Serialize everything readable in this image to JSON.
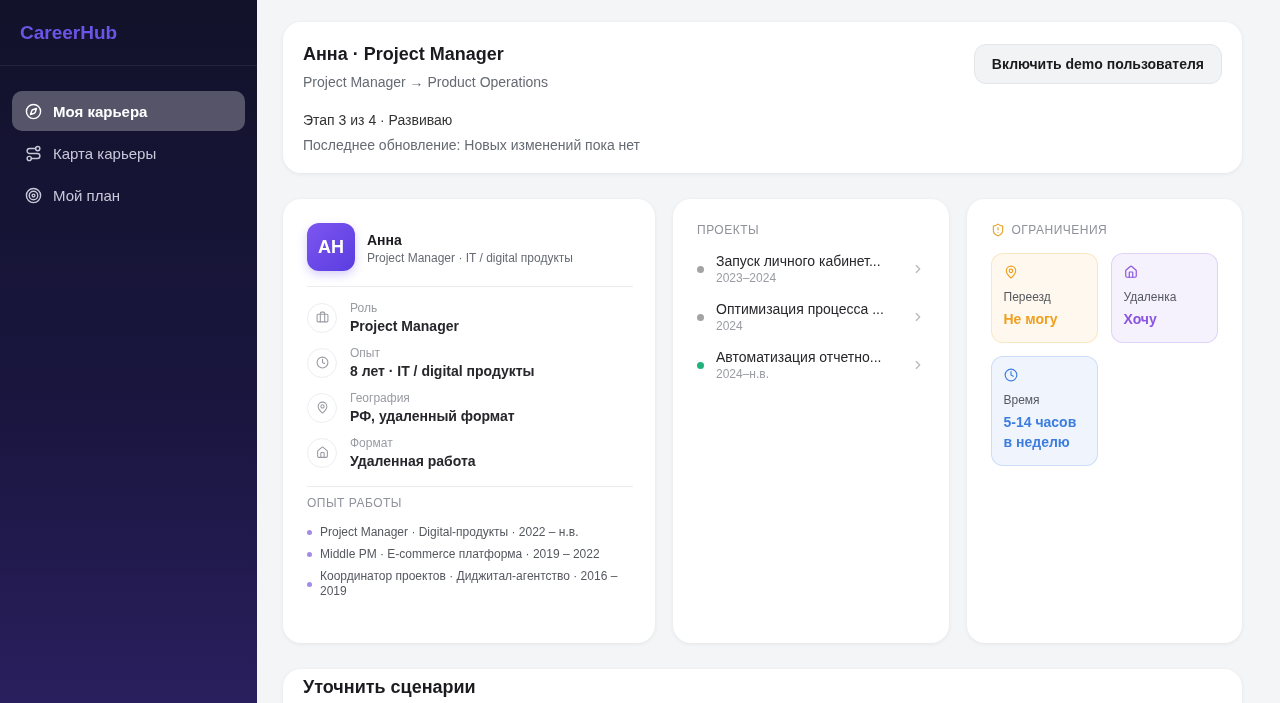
{
  "app": {
    "logo": "CareerHub"
  },
  "sidebar": {
    "items": [
      {
        "label": "Моя карьера",
        "selected": true
      },
      {
        "label": "Карта карьеры",
        "selected": false
      },
      {
        "label": "Мой план",
        "selected": false
      }
    ]
  },
  "header": {
    "title": "Анна · Project Manager",
    "path": "Project Manager → Product Operations",
    "stage": "Этап 3 из 4 · Развиваю",
    "update": "Последнее обновление: Новых изменений пока нет",
    "button": "Включить demo пользователя"
  },
  "profile": {
    "initials": "АН",
    "name": "Анна",
    "subtitle": "Project Manager · IT / digital продукты",
    "facts": [
      {
        "label": "Роль",
        "value": "Project Manager"
      },
      {
        "label": "Опыт",
        "value": "8 лет · IT / digital продукты"
      },
      {
        "label": "География",
        "value": "РФ, удаленный формат"
      },
      {
        "label": "Формат",
        "value": "Удаленная работа"
      }
    ],
    "history_title": "ОПЫТ РАБОТЫ",
    "history": [
      "Project Manager · Digital-продукты · 2022 – н.в.",
      "Middle PM · E-commerce платформа · 2019 – 2022",
      "Координатор проектов · Диджитал-агентство · 2016 – 2019"
    ]
  },
  "projects": {
    "title": "ПРОЕКТЫ",
    "items": [
      {
        "name": "Запуск личного кабинет...",
        "period": "2023–2024",
        "color": "#a3a3a6"
      },
      {
        "name": "Оптимизация процесса ...",
        "period": "2024",
        "color": "#a3a3a6"
      },
      {
        "name": "Автоматизация отчетно...",
        "period": "2024–н.в.",
        "color": "#20b27a"
      }
    ]
  },
  "limits": {
    "title": "ОГРАНИЧЕНИЯ",
    "items": [
      {
        "label": "Переезд",
        "value": "Не могу",
        "color": "#f0a020"
      },
      {
        "label": "Удаленка",
        "value": "Хочу",
        "color": "#8a55e0"
      },
      {
        "label": "Время",
        "value": "5-14 часов в неделю",
        "color": "#3d7de0"
      }
    ]
  },
  "scenario": {
    "title": "Уточнить сценарии"
  }
}
